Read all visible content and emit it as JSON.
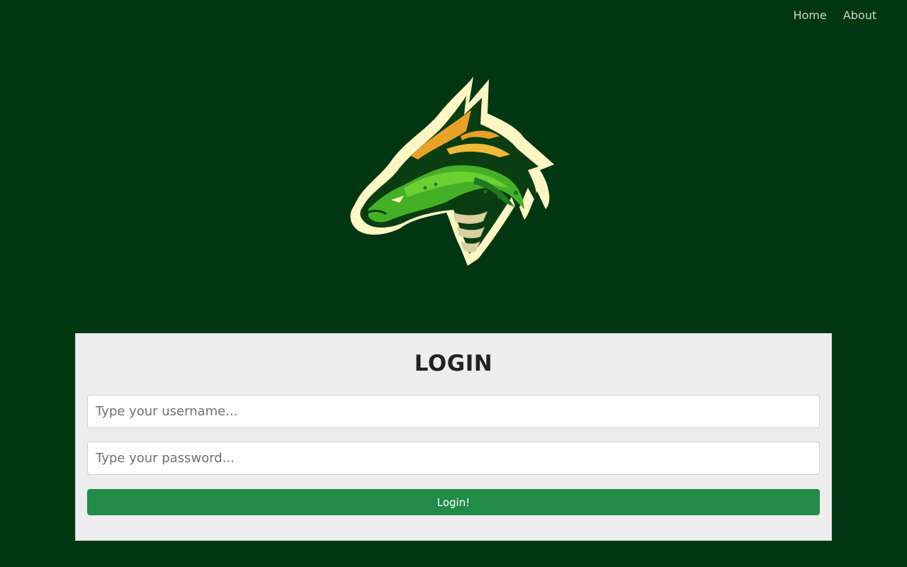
{
  "nav": {
    "items": [
      {
        "label": "Home"
      },
      {
        "label": "About"
      }
    ]
  },
  "logo": {
    "icon": "dragon-logo",
    "colors": {
      "outline": "#fdf7c3",
      "green": "#44b026",
      "dark_green": "#1f7a1f",
      "orange": "#e8a227",
      "shadow": "#0b3d12"
    }
  },
  "login": {
    "title": "LOGIN",
    "username_placeholder": "Type your username...",
    "password_placeholder": "Type your password...",
    "button_label": "Login!"
  },
  "colors": {
    "background": "#013613",
    "card": "#ededed",
    "button": "#208c47"
  }
}
